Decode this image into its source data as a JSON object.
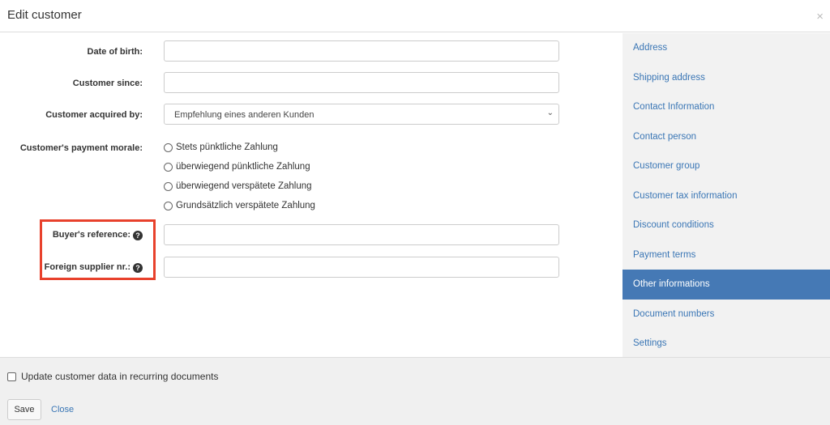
{
  "header": {
    "title": "Edit customer",
    "close_icon": "×"
  },
  "form": {
    "date_of_birth": {
      "label": "Date of birth:",
      "value": ""
    },
    "customer_since": {
      "label": "Customer since:",
      "value": ""
    },
    "acquired_by": {
      "label": "Customer acquired by:",
      "value": "Empfehlung eines anderen Kunden"
    },
    "payment_morale": {
      "label": "Customer's payment morale:",
      "options": [
        "Stets pünktliche Zahlung",
        "überwiegend pünktliche Zahlung",
        "überwiegend verspätete Zahlung",
        "Grundsätzlich verspätete Zahlung"
      ]
    },
    "buyers_reference": {
      "label": "Buyer's reference:",
      "value": ""
    },
    "foreign_supplier": {
      "label": "Foreign supplier nr.:",
      "value": ""
    },
    "help_icon": "?",
    "highlight_color": "#e8412c"
  },
  "sidebar": {
    "items": [
      "Address",
      "Shipping address",
      "Contact Information",
      "Contact person",
      "Customer group",
      "Customer tax information",
      "Discount conditions",
      "Payment terms",
      "Other informations",
      "Document numbers",
      "Settings"
    ],
    "active": "Other informations"
  },
  "footer": {
    "checkbox_label": "Update customer data in recurring documents",
    "save": "Save",
    "close": "Close"
  }
}
